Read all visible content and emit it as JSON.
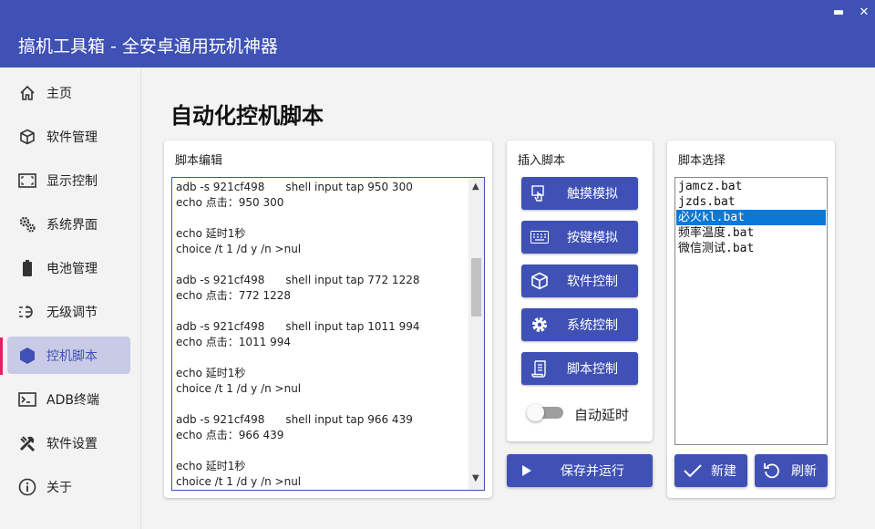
{
  "window": {
    "title": "搞机工具箱 - 全安卓通用玩机神器",
    "minimize_glyph": "▬",
    "close_glyph": "✕"
  },
  "sidebar": {
    "items": [
      {
        "label": "主页",
        "icon": "home-icon"
      },
      {
        "label": "软件管理",
        "icon": "package-icon"
      },
      {
        "label": "显示控制",
        "icon": "screen-icon"
      },
      {
        "label": "系统界面",
        "icon": "gears-icon"
      },
      {
        "label": "电池管理",
        "icon": "battery-icon"
      },
      {
        "label": "无级调节",
        "icon": "slider-icon"
      },
      {
        "label": "控机脚本",
        "icon": "hexagon-icon",
        "active": true
      },
      {
        "label": "ADB终端",
        "icon": "terminal-icon"
      },
      {
        "label": "软件设置",
        "icon": "tools-icon"
      },
      {
        "label": "关于",
        "icon": "info-icon"
      }
    ],
    "active_color": "#3f51b5",
    "active_marker_color": "#e91e63"
  },
  "main": {
    "page_title": "自动化控机脚本"
  },
  "editor_card": {
    "title": "脚本编辑",
    "lines": [
      "adb -s 921cf498      shell input tap 950 300",
      "echo 点击：950 300",
      "",
      "echo 延时1秒",
      "choice /t 1 /d y /n >nul",
      "",
      "adb -s 921cf498      shell input tap 772 1228",
      "echo 点击：772 1228",
      "",
      "adb -s 921cf498      shell input tap 1011 994",
      "echo 点击：1011 994",
      "",
      "echo 延时1秒",
      "choice /t 1 /d y /n >nul",
      "",
      "adb -s 921cf498      shell input tap 966 439",
      "echo 点击：966 439",
      "",
      "echo 延时1秒",
      "choice /t 1 /d y /n >nul"
    ],
    "scroll_up_glyph": "▲",
    "scroll_down_glyph": "▼"
  },
  "insert_card": {
    "title": "插入脚本",
    "buttons": [
      {
        "label": "触摸模拟",
        "icon": "touch-icon"
      },
      {
        "label": "按键模拟",
        "icon": "keyboard-icon"
      },
      {
        "label": "软件控制",
        "icon": "cube-icon"
      },
      {
        "label": "系统控制",
        "icon": "gear-icon"
      },
      {
        "label": "脚本控制",
        "icon": "script-icon"
      }
    ],
    "toggle_label": "自动延时",
    "toggle_on": false
  },
  "save_run_button": {
    "label": "保存并运行",
    "icon": "play-icon"
  },
  "select_card": {
    "title": "脚本选择",
    "files": [
      "jamcz.bat",
      "jzds.bat",
      "必火kl.bat",
      "频率温度.bat",
      "微信测试.bat"
    ],
    "selected_index": 2,
    "new_label": "新建",
    "refresh_label": "刷新"
  },
  "colors": {
    "accent": "#3f51b5",
    "selection": "#0a78d7"
  }
}
